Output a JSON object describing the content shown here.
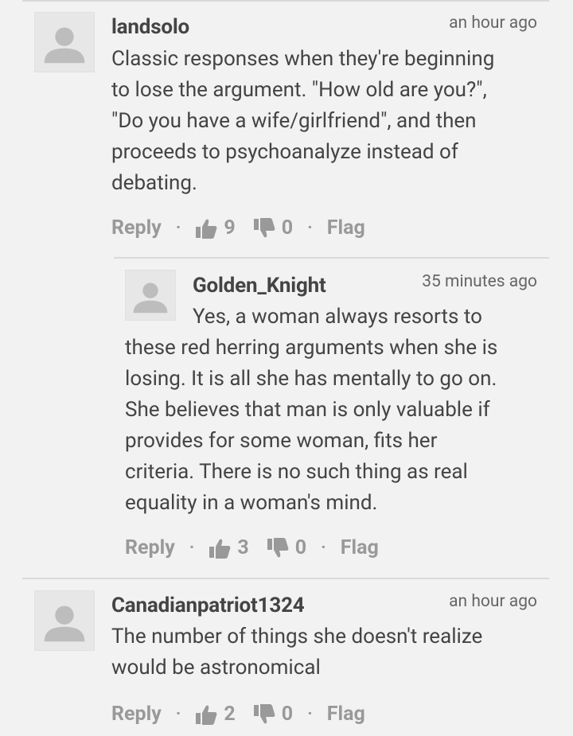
{
  "comments": [
    {
      "author": "landsolo",
      "time": "an hour ago",
      "lines": [
        "Classic responses when they're beginning",
        "to lose the argument. \"How old are you?\",",
        "\"Do you have a wife/girlfriend\", and then",
        "proceeds to psychoanalyze instead of",
        "debating."
      ],
      "reply_label": "Reply",
      "upvotes": "9",
      "downvotes": "0",
      "flag_label": "Flag"
    },
    {
      "author": "Golden_Knight",
      "time": "35 minutes ago",
      "lines": [
        "Yes, a woman always resorts to",
        "these red herring arguments when she is",
        "losing. It is all she has mentally to go on.",
        "She believes that man is only valuable if",
        "provides for some woman, fits her",
        "criteria. There is no such thing as real",
        "equality in a woman's mind."
      ],
      "reply_label": "Reply",
      "upvotes": "3",
      "downvotes": "0",
      "flag_label": "Flag"
    },
    {
      "author": "Canadianpatriot1324",
      "time": "an hour ago",
      "lines": [
        "The number of things she doesn't realize",
        "would be astronomical"
      ],
      "reply_label": "Reply",
      "upvotes": "2",
      "downvotes": "0",
      "flag_label": "Flag"
    }
  ],
  "colors": {
    "background": "#f2f2f2",
    "text": "#444444",
    "muted": "#999999",
    "avatar_bg": "#e7e7e7",
    "avatar_fg": "#bdbdbd"
  },
  "icons": {
    "avatar": "user-silhouette-icon",
    "upvote": "thumbs-up-icon",
    "downvote": "thumbs-down-icon"
  },
  "separator": "·"
}
